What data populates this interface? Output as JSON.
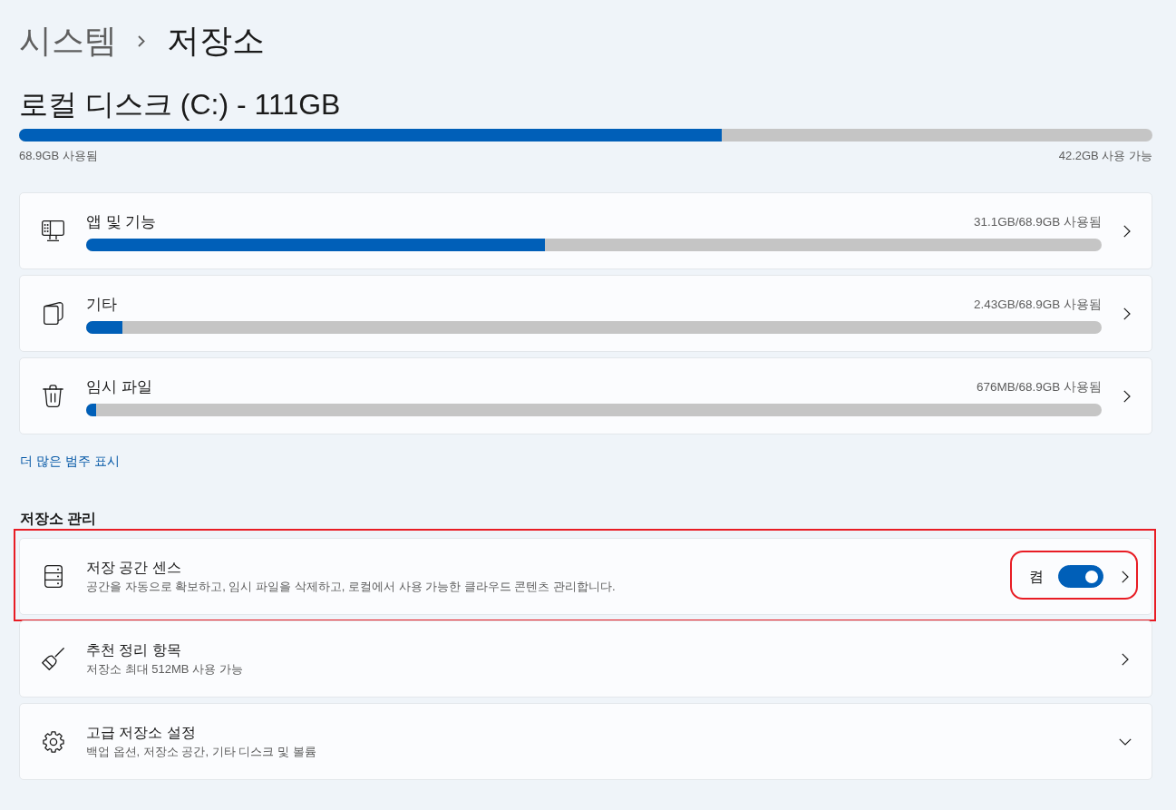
{
  "breadcrumb": [
    {
      "label": "시스템"
    },
    {
      "label": "저장소"
    }
  ],
  "disk": {
    "title": "로컬 디스크 (C:) - 111GB",
    "level": 0.62,
    "used": "68.9GB 사용됨",
    "free": "42.2GB 사용 가능"
  },
  "categories": [
    {
      "name": "앱 및 기능",
      "usage": "31.1GB/68.9GB 사용됨",
      "level": 0.452
    },
    {
      "name": "기타",
      "usage": "2.43GB/68.9GB 사용됨",
      "level": 0.036
    },
    {
      "name": "임시 파일",
      "usage": "676MB/68.9GB 사용됨",
      "level": 0.01
    }
  ],
  "more_link": "더 많은 범주 표시",
  "management": {
    "heading": "저장소 관리",
    "items": [
      {
        "kind": "toggle",
        "title": "저장 공간 센스",
        "description": "공간을 자동으로 확보하고, 임시 파일을 삭제하고, 로컬에서 사용 가능한 클라우드 콘텐츠 관리합니다.",
        "state_label": "켬",
        "on": true,
        "highlighted": true
      },
      {
        "kind": "link",
        "title": "추천 정리 항목",
        "description": "저장소 최대 512MB 사용 가능",
        "highlighted": false
      },
      {
        "kind": "expander",
        "title": "고급 저장소 설정",
        "description": "백업 옵션, 저장소 공간, 기타 디스크 및 볼륨",
        "expanded": false,
        "highlighted": false
      }
    ]
  }
}
